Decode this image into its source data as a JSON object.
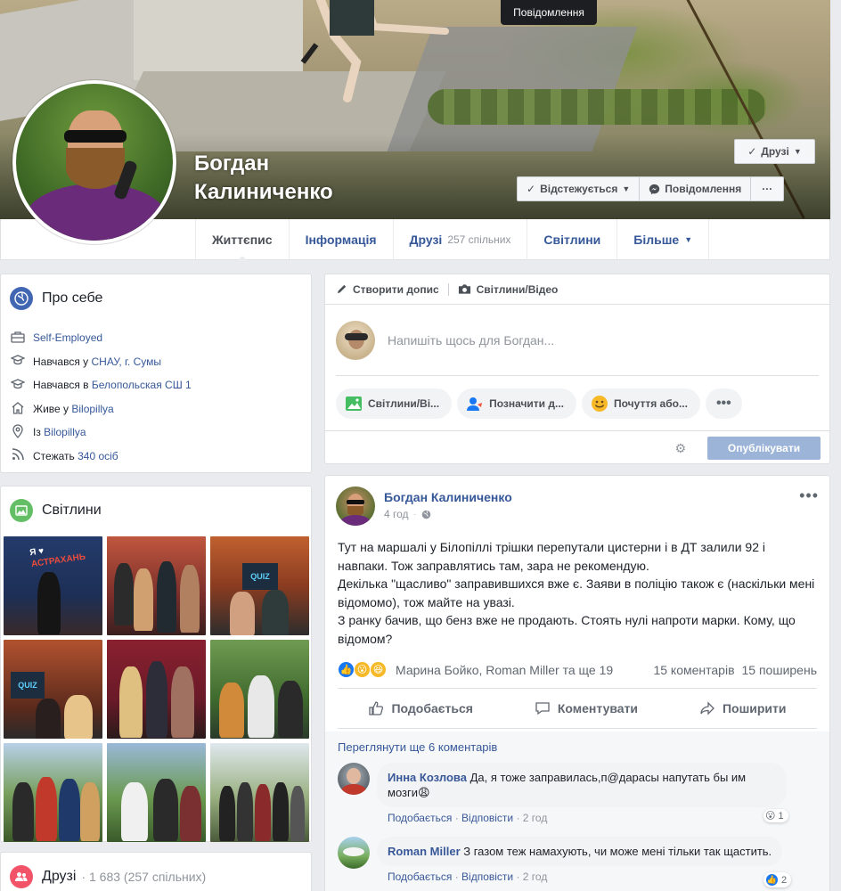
{
  "tooltip": "Повідомлення",
  "profile": {
    "name_line1": "Богдан",
    "name_line2": "Калиниченко"
  },
  "buttons": {
    "friends": "Друзі",
    "following": "Відстежується",
    "message": "Повідомлення",
    "more": "···"
  },
  "tabs": [
    {
      "label": "Життєпис"
    },
    {
      "label": "Інформація"
    },
    {
      "label": "Друзі",
      "count": "257 спільних"
    },
    {
      "label": "Світлини"
    },
    {
      "label": "Більше"
    }
  ],
  "about": {
    "title": "Про себе",
    "rows": [
      {
        "icon": "briefcase-icon",
        "link": "Self-Employed"
      },
      {
        "icon": "graduation-cap-icon",
        "prefix": "Навчався у ",
        "link": "СНАУ, г. Сумы"
      },
      {
        "icon": "graduation-cap-icon",
        "prefix": "Навчався в ",
        "link": "Белопольская СШ 1"
      },
      {
        "icon": "home-icon",
        "prefix": "Живе у ",
        "link": "Bilopillya"
      },
      {
        "icon": "location-pin-icon",
        "prefix": "Із ",
        "link": "Bilopillya"
      },
      {
        "icon": "rss-icon",
        "prefix": "Стежать ",
        "link": "340 осіб"
      }
    ]
  },
  "photos": {
    "title": "Світлини",
    "signage": [
      "Я ♥",
      "АСТРАХАНЬ",
      "QUIZ",
      "QUIZ"
    ]
  },
  "friends": {
    "title": "Друзі",
    "count": "· 1 683 (257 спільних)"
  },
  "composer": {
    "create_post": "Створити допис",
    "photo_video": "Світлини/Відео",
    "placeholder": "Напишіть щось для Богдан...",
    "chips": [
      "Світлини/Ві...",
      "Позначити д...",
      "Почуття або..."
    ],
    "publish": "Опублікувати"
  },
  "post": {
    "author": "Богдан Калиниченко",
    "time": "4 год",
    "text": "Тут на маршалі у Білопіллі трішки перепутали цистерни і в ДТ залили 92 і навпаки. Тож заправлятись там, зара не рекомендую.\nДекілька \"щасливо\" заправившихся вже є. Заяви в поліцію також є (наскільки мені відомомо), тож майте на увазі.\nЗ ранку бачив, що бенз вже не продають. Стоять нулі напроти марки. Кому, що відомом?",
    "reactions_text": "Марина Бойко, Roman Miller та ще 19",
    "comments_count": "15 коментарів",
    "shares_count": "15 поширень",
    "like": "Подобається",
    "comment": "Коментувати",
    "share": "Поширити"
  },
  "comments": {
    "view_more": "Переглянути ще 6 коментарів",
    "items": [
      {
        "author": "Инна Козлова",
        "text": "Да, я тоже заправилась,п@дарасы напутать бы им мозги😩",
        "like": "Подобається",
        "reply": "Відповісти",
        "time": "2 год",
        "reaction_count": "1"
      },
      {
        "author": "Roman Miller",
        "text": "З газом теж намахують, чи може мені тільки так щастить.",
        "like": "Подобається",
        "reply": "Відповісти",
        "time": "2 год",
        "reaction_count": "2"
      }
    ]
  },
  "colors": {
    "link": "#365899",
    "fb_bg": "#e9ebee",
    "publish_disabled": "#9cb4d8"
  }
}
